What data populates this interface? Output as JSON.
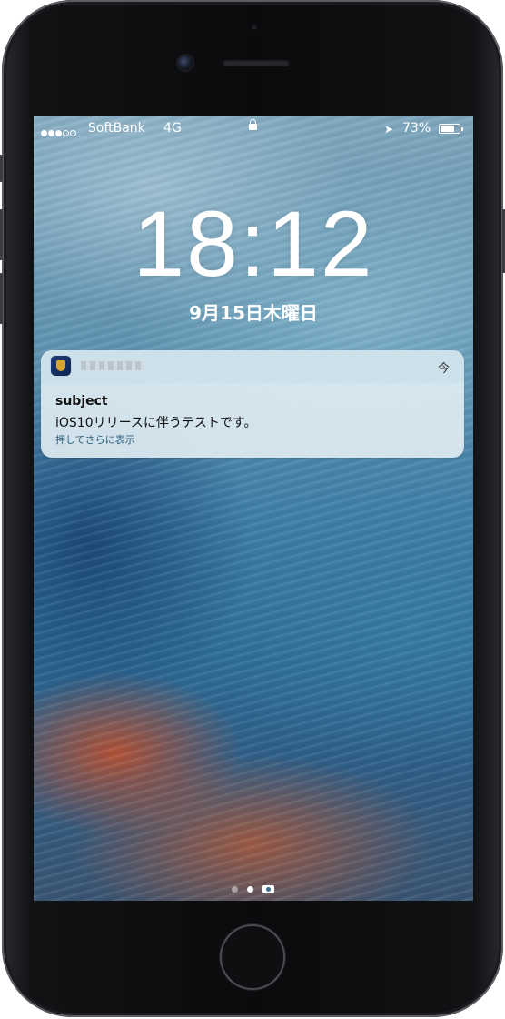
{
  "status_bar": {
    "signal_bars_filled": 3,
    "signal_bars_total": 5,
    "carrier": "SoftBank",
    "network": "4G",
    "location_icon": "location-arrow-icon",
    "battery_percent_text": "73%",
    "battery_level": 0.73
  },
  "lock_screen": {
    "time": "18:12",
    "date": "9月15日木曜日"
  },
  "notification": {
    "app_icon": "app-icon",
    "app_name": "",
    "time": "今",
    "title": "subject",
    "body": "iOS10リリースに伴うテストです。",
    "hint": "押してさらに表示"
  },
  "page_indicator": {
    "pages": 2,
    "current": 2,
    "camera_icon": "camera-icon"
  }
}
